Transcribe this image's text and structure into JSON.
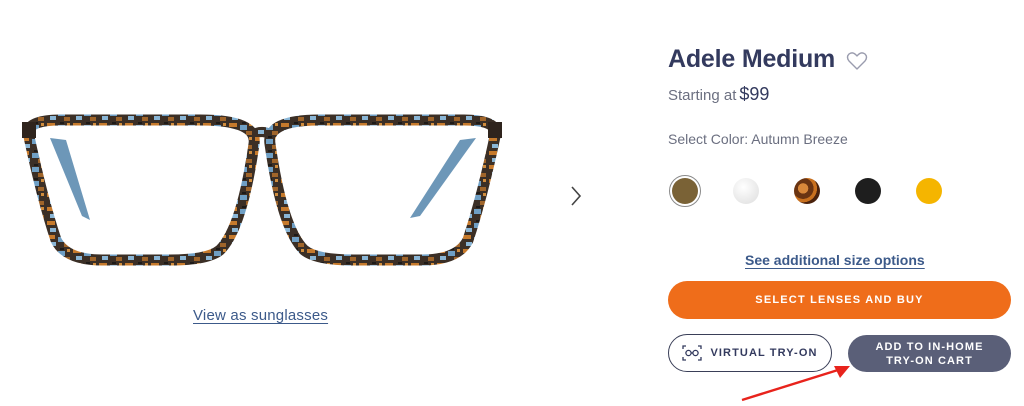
{
  "product": {
    "title": "Adele Medium",
    "starting_label": "Starting at",
    "price": "$99",
    "color_label": "Select Color: Autumn Breeze"
  },
  "media": {
    "view_sunglasses_link": "View as sunglasses",
    "next_icon": "chevron-right-icon"
  },
  "colors": [
    {
      "name": "Autumn Breeze",
      "hex": "#7a6236",
      "selected": true
    },
    {
      "name": "Crystal",
      "hex": "#eeeeee"
    },
    {
      "name": "Tortoise",
      "hex": "#8a4a1c"
    },
    {
      "name": "Black",
      "hex": "#1e1e1e"
    },
    {
      "name": "Yellow",
      "hex": "#f5b500"
    }
  ],
  "actions": {
    "size_options_link": "See additional size options",
    "select_lenses_label": "SELECT LENSES AND BUY",
    "virtual_tryon_label": "VIRTUAL TRY-ON",
    "home_tryon_line1": "ADD TO IN-HOME",
    "home_tryon_line2": "TRY-ON CART"
  },
  "theme": {
    "accent_orange": "#ef6d1a",
    "navy": "#333a5e",
    "slate_button": "#5a5f78",
    "link_blue": "#3c5a8a",
    "annotation_red": "#e8231c"
  }
}
